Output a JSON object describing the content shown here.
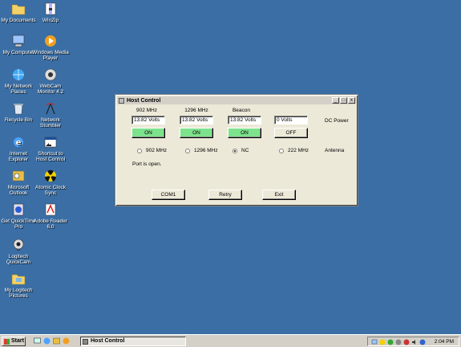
{
  "desktop": {
    "icons": [
      {
        "label": "My Documents",
        "icon": "folder-icon"
      },
      {
        "label": "WinZip",
        "icon": "winzip-icon"
      },
      {
        "label": "My Computer",
        "icon": "computer-icon"
      },
      {
        "label": "Windows Media Player",
        "icon": "media-player-icon"
      },
      {
        "label": "My Network Places",
        "icon": "network-places-icon"
      },
      {
        "label": "WebCam Monitor 4.2",
        "icon": "webcam-monitor-icon"
      },
      {
        "label": "Recycle Bin",
        "icon": "recycle-bin-icon"
      },
      {
        "label": "Network Stumbler",
        "icon": "network-stumbler-icon"
      },
      {
        "label": "Internet Explorer",
        "icon": "internet-explorer-icon"
      },
      {
        "label": "Shortcut to Host Control",
        "icon": "shortcut-icon"
      },
      {
        "label": "Microsoft Outlook",
        "icon": "outlook-icon"
      },
      {
        "label": "Atomic Clock Sync",
        "icon": "radiation-icon"
      },
      {
        "label": "Get QuickTime Pro",
        "icon": "quicktime-icon"
      },
      {
        "label": "Adobe Reader 6.0",
        "icon": "adobe-reader-icon"
      },
      {
        "label": "Logitech QuickCam",
        "icon": "webcam-icon"
      },
      {
        "label": "My Logitech Pictures",
        "icon": "pictures-folder-icon"
      }
    ]
  },
  "window": {
    "title": "Host Control",
    "controls": {
      "minimize": "_",
      "maximize": "□",
      "close": "x"
    },
    "columns": [
      "902 MHz",
      "1296 MHz",
      "Beacon"
    ],
    "voltages": [
      "13.82 Volts",
      "13.82 Volts",
      "13.82 Volts",
      "0 Volts"
    ],
    "power_buttons": [
      "ON",
      "ON",
      "ON",
      "OFF"
    ],
    "dc_power_label": "DC Power",
    "antenna_options": [
      "902 MHz",
      "1296 MHz",
      "NC",
      "222 MHz"
    ],
    "antenna_selected": "NC",
    "antenna_label": "Antenna",
    "status": "Port is open.",
    "buttons": {
      "com": "COM1",
      "retry": "Retry",
      "exit": "Exit"
    }
  },
  "taskbar": {
    "start_label": "Start",
    "task_label": "Host Control",
    "clock": "2:04 PM"
  },
  "colors": {
    "desktop": "#3a6ea5",
    "on_button": "#7de28c",
    "window_face": "#ece9d8"
  }
}
